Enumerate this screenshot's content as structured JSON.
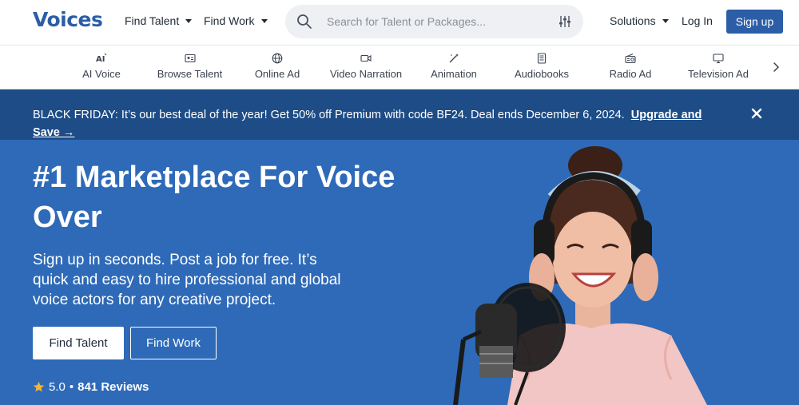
{
  "brand": {
    "logo_text": "Voices",
    "color": "#2c5ea7"
  },
  "header": {
    "nav": [
      {
        "label": "Find Talent"
      },
      {
        "label": "Find Work"
      }
    ],
    "search": {
      "placeholder": "Search for Talent or Packages...",
      "value": ""
    },
    "solutions_label": "Solutions",
    "login_label": "Log In",
    "signup_label": "Sign up"
  },
  "categories": [
    {
      "label": "AI Voice",
      "icon": "ai-icon"
    },
    {
      "label": "Browse Talent",
      "icon": "id-card-icon"
    },
    {
      "label": "Online Ad",
      "icon": "globe-icon"
    },
    {
      "label": "Video Narration",
      "icon": "video-camera-icon"
    },
    {
      "label": "Animation",
      "icon": "magic-wand-icon"
    },
    {
      "label": "Audiobooks",
      "icon": "book-icon"
    },
    {
      "label": "Radio Ad",
      "icon": "radio-icon"
    },
    {
      "label": "Television Ad",
      "icon": "monitor-icon"
    }
  ],
  "promo": {
    "text": "BLACK FRIDAY: It’s our best deal of the year! Get 50% off Premium with code BF24. Deal ends December 6, 2024.",
    "link_label": "Upgrade and Save →",
    "background": "#1d4c86"
  },
  "hero": {
    "title": "#1 Marketplace For Voice Over",
    "subtitle": "Sign up in seconds. Post a job for free. It’s quick and easy to hire professional and global voice actors for any creative project.",
    "primary_button": "Find Talent",
    "secondary_button": "Find Work",
    "rating_value": "5.0",
    "rating_separator": "•",
    "reviews_label": "841 Reviews",
    "background": "#2e6ab8"
  }
}
